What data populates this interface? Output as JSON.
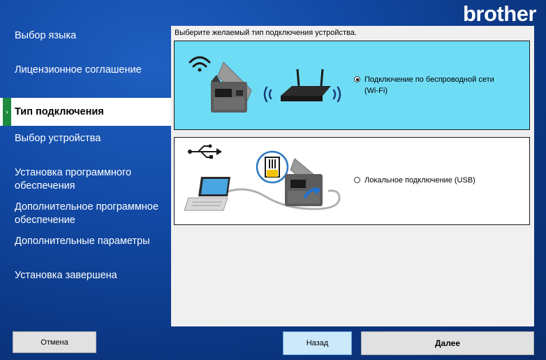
{
  "brand": "brother",
  "nav": {
    "items": [
      {
        "label": "Выбор языка"
      },
      {
        "label": "Лицензионное соглашение"
      },
      {
        "label": "Тип подключения"
      },
      {
        "label": "Выбор устройства"
      },
      {
        "label_line1": "Установка программного",
        "label_line2": "обеспечения"
      },
      {
        "label_line1": "Дополнительное программное",
        "label_line2": "обеспечение"
      },
      {
        "label": "Дополнительные параметры"
      },
      {
        "label": "Установка завершена"
      }
    ],
    "active_index": 2
  },
  "main": {
    "prompt": "Выберите желаемый тип подключения устройства.",
    "options": [
      {
        "line1": "Подключение по беспроводной сети",
        "line2": "(Wi-Fi)",
        "selected": true,
        "icon": "wifi-printer-router-illustration"
      },
      {
        "line1": "Локальное подключение (USB)",
        "selected": false,
        "icon": "usb-laptop-printer-illustration"
      }
    ]
  },
  "buttons": {
    "cancel": "Отмена",
    "back": "Назад",
    "next": "Далее"
  },
  "colors": {
    "background": "#124aa6",
    "wifi_option": "#6fdcf5",
    "active_marker": "#1e8a3d",
    "back_button": "#cce8fb"
  }
}
